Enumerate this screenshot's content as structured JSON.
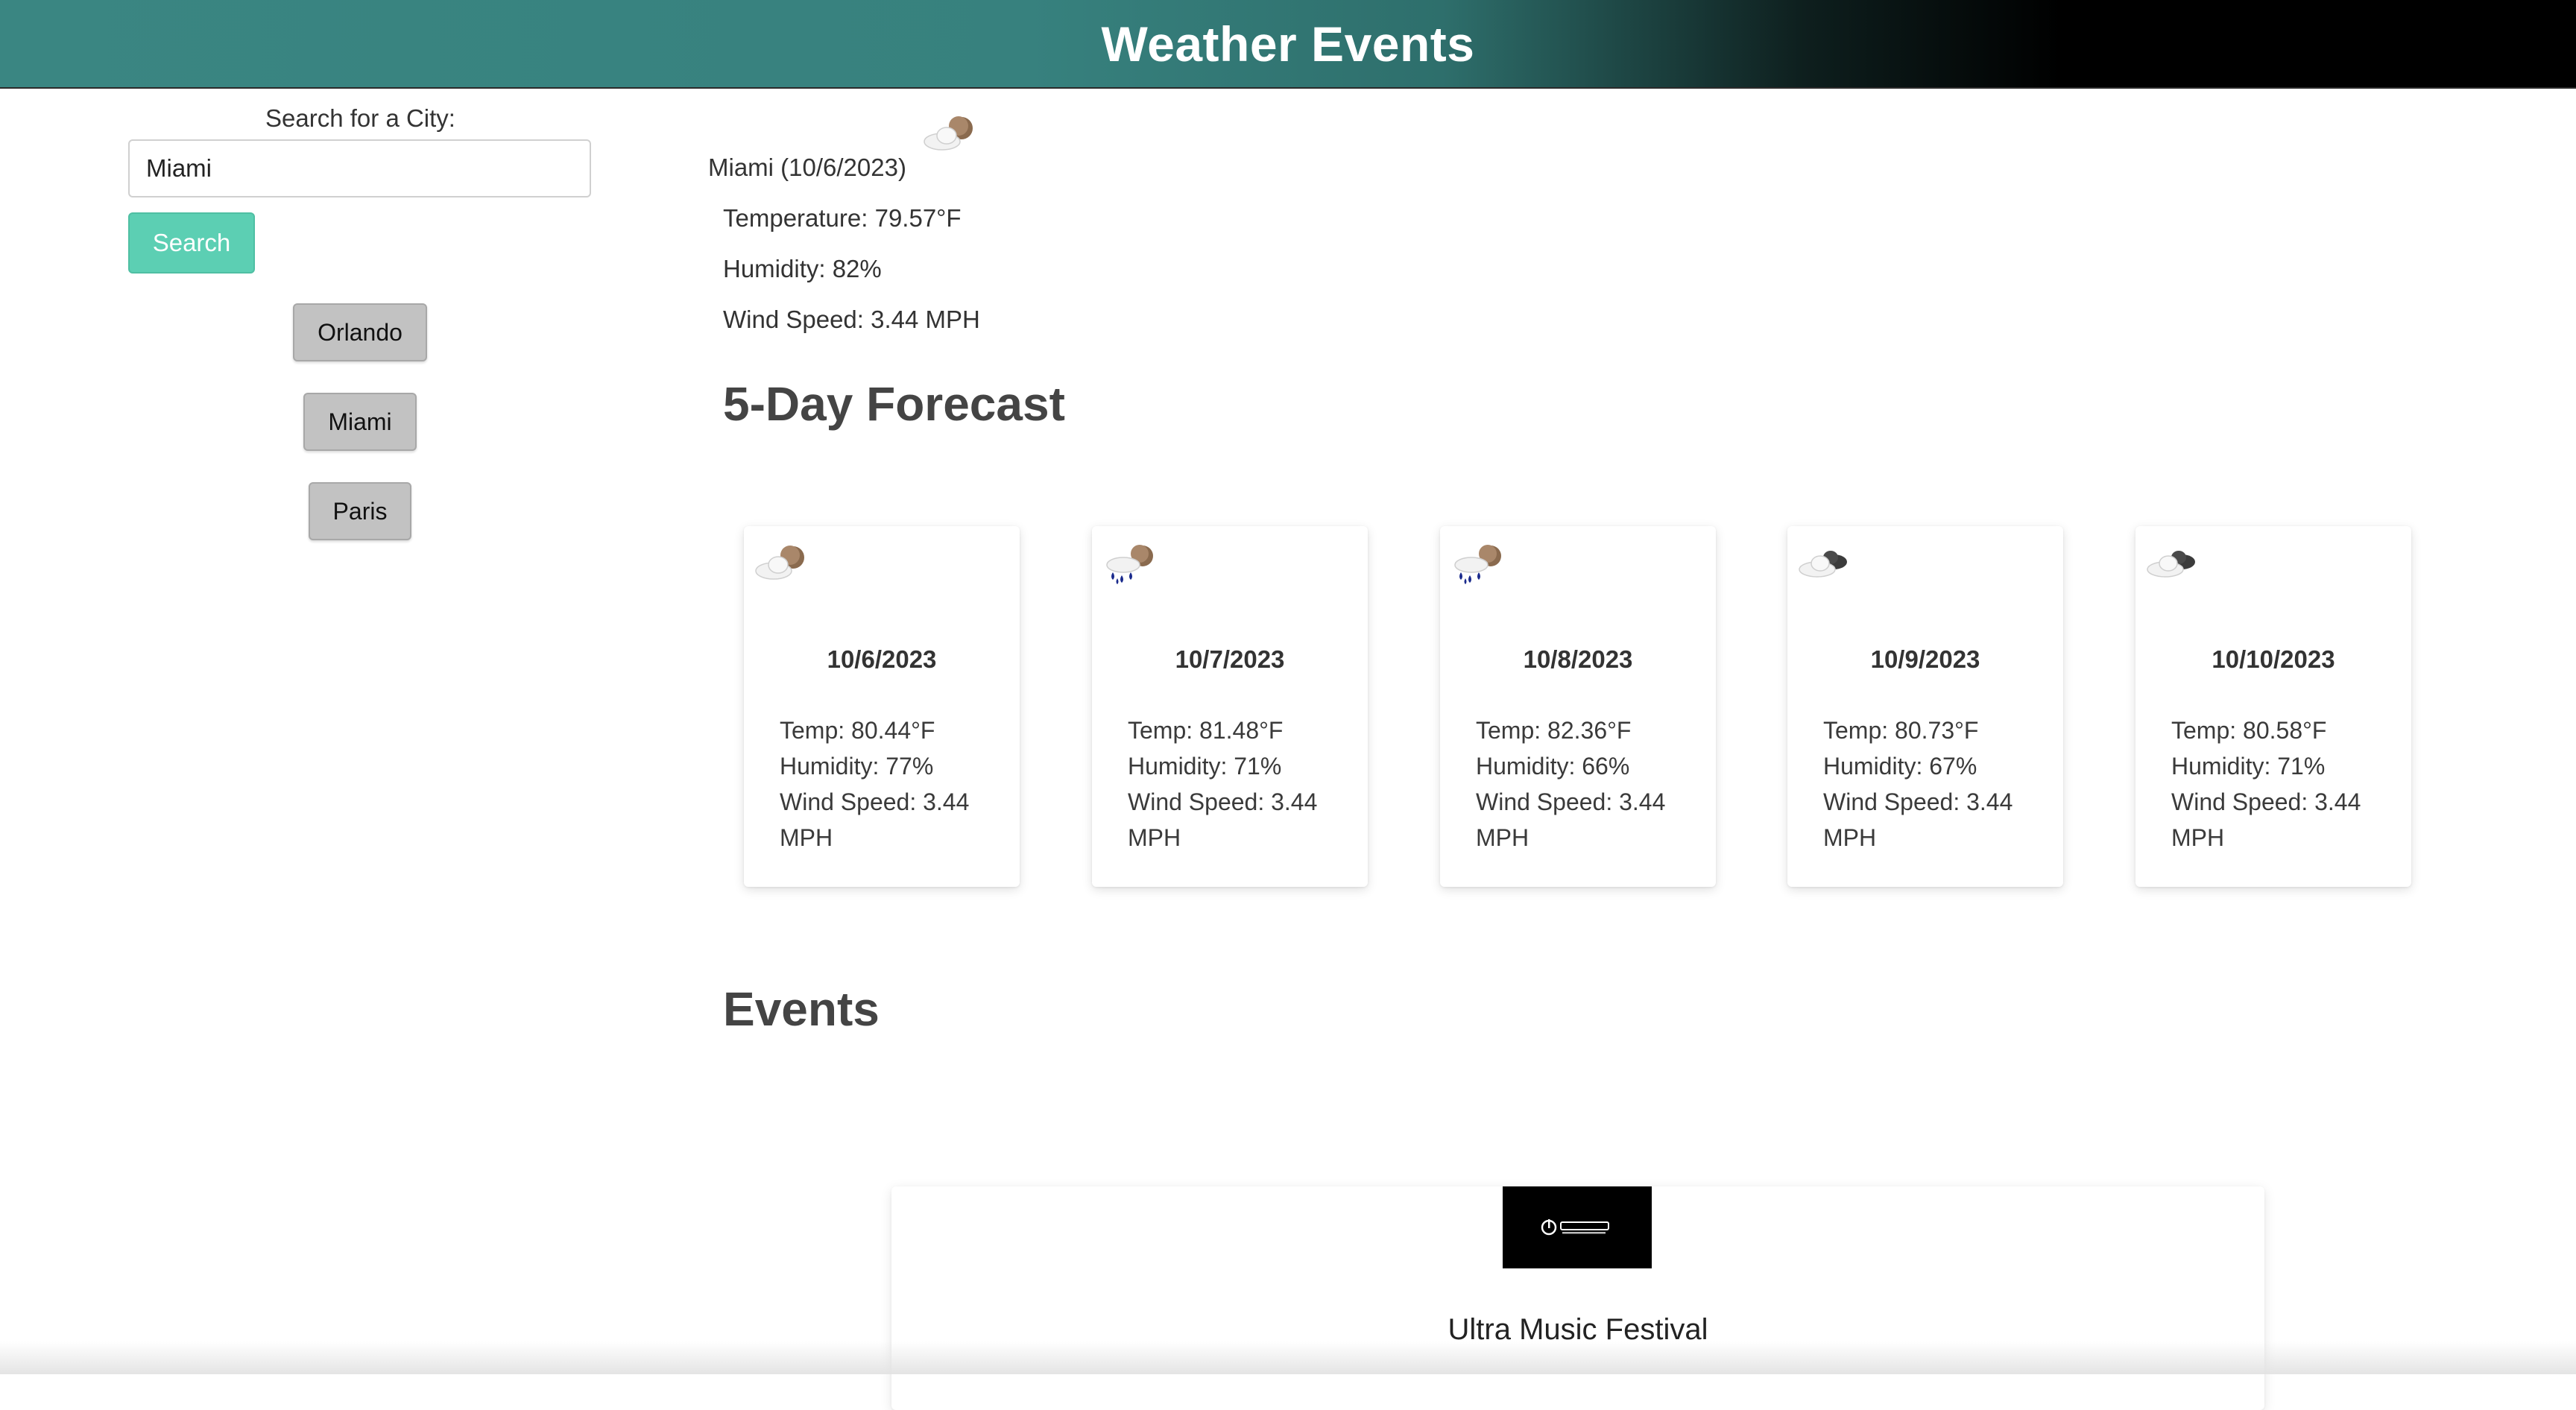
{
  "header": {
    "title": "Weather Events"
  },
  "search": {
    "label": "Search for a City:",
    "value": "Miami",
    "placeholder": "",
    "button_label": "Search"
  },
  "history": [
    {
      "label": "Orlando"
    },
    {
      "label": "Miami"
    },
    {
      "label": "Paris"
    }
  ],
  "current": {
    "title": "Miami (10/6/2023)",
    "icon": "partly-cloudy-night-icon",
    "temperature": "Temperature: 79.57°F",
    "humidity": "Humidity: 82%",
    "wind": "Wind Speed: 3.44 MPH"
  },
  "forecast_heading": "5-Day Forecast",
  "forecast": [
    {
      "date": "10/6/2023",
      "icon": "partly-cloudy-night-icon",
      "temp": "Temp: 80.44°F",
      "humidity": "Humidity: 77%",
      "wind": "Wind Speed: 3.44 MPH"
    },
    {
      "date": "10/7/2023",
      "icon": "rain-night-icon",
      "temp": "Temp: 81.48°F",
      "humidity": "Humidity: 71%",
      "wind": "Wind Speed: 3.44 MPH"
    },
    {
      "date": "10/8/2023",
      "icon": "rain-night-icon",
      "temp": "Temp: 82.36°F",
      "humidity": "Humidity: 66%",
      "wind": "Wind Speed: 3.44 MPH"
    },
    {
      "date": "10/9/2023",
      "icon": "cloudy-icon",
      "temp": "Temp: 80.73°F",
      "humidity": "Humidity: 67%",
      "wind": "Wind Speed: 3.44 MPH"
    },
    {
      "date": "10/10/2023",
      "icon": "cloudy-icon",
      "temp": "Temp: 80.58°F",
      "humidity": "Humidity: 71%",
      "wind": "Wind Speed: 3.44 MPH"
    }
  ],
  "events_heading": "Events",
  "events": [
    {
      "title": "Ultra Music Festival",
      "logo": "ultra-music-festival-logo"
    }
  ]
}
